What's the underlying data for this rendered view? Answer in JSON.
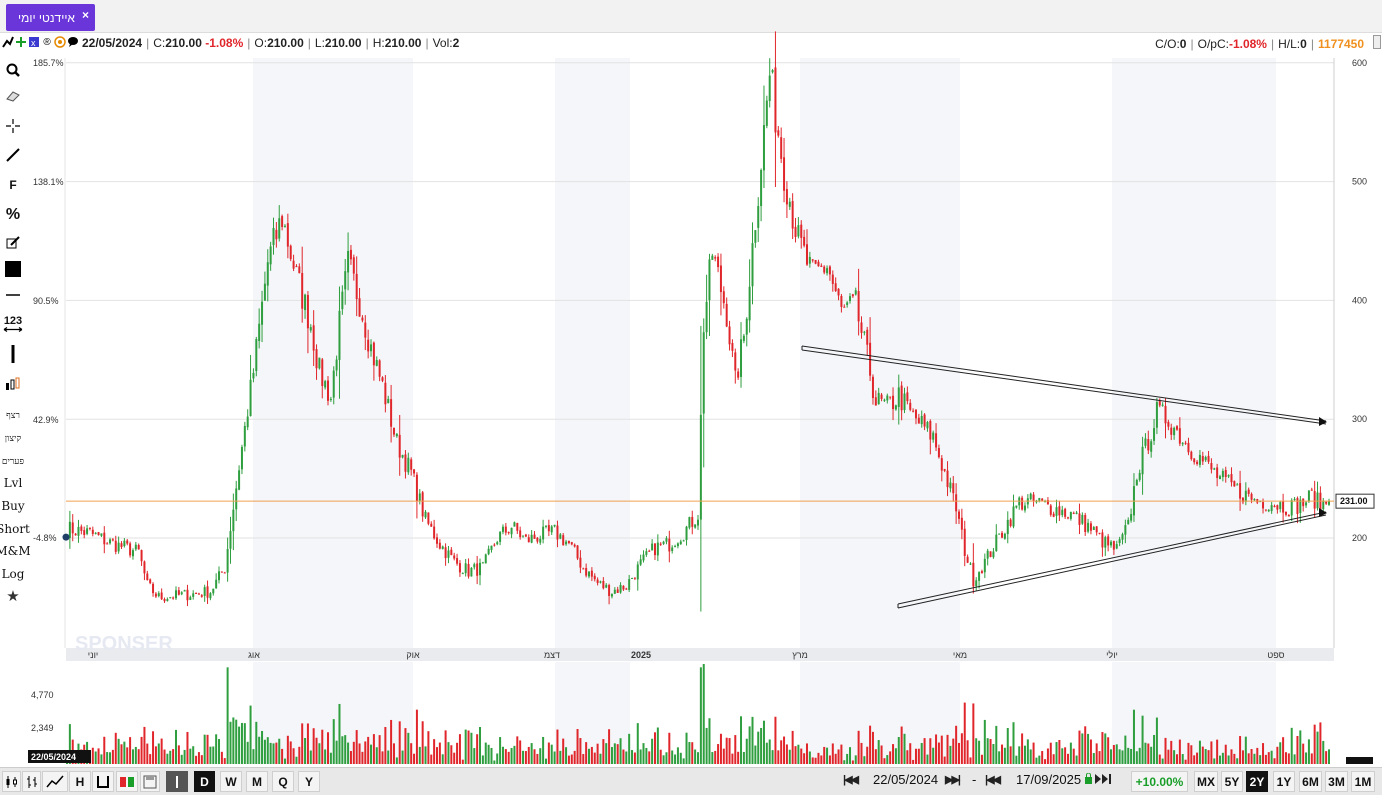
{
  "tab": {
    "title": "איידנטי יומי",
    "close": "×"
  },
  "info": {
    "date": "22/05/2024",
    "c_label": "C:",
    "c_value": "210.00",
    "c_change": "-1.08%",
    "o_label": "O:",
    "o_value": "210.00",
    "l_label": "L:",
    "l_value": "210.00",
    "h_label": "H:",
    "h_value": "210.00",
    "vol_label": "Vol:",
    "vol_value": "2",
    "co_label": "C/O:",
    "co_value": "0",
    "opc_label": "O/pC:",
    "opc_value": "-1.08%",
    "hl_label": "H/L:",
    "hl_value": "0",
    "symbol_id": "1177450"
  },
  "toolbar": {
    "items": [
      {
        "name": "search-icon",
        "label": ""
      },
      {
        "name": "eraser-icon",
        "label": ""
      },
      {
        "name": "crosshair-icon",
        "label": ""
      },
      {
        "name": "line-tool-icon",
        "label": ""
      },
      {
        "name": "fibonacci-tool",
        "label": "F"
      },
      {
        "name": "percent-tool",
        "label": "%"
      },
      {
        "name": "edit-icon",
        "label": ""
      },
      {
        "name": "color-swatch",
        "label": ""
      },
      {
        "name": "horizontal-line-icon",
        "label": ""
      },
      {
        "name": "numbering-tool",
        "label": "123"
      },
      {
        "name": "vertical-line-icon",
        "label": ""
      },
      {
        "name": "candles-icon",
        "label": ""
      },
      {
        "name": "tool-retzef",
        "label": "רצף"
      },
      {
        "name": "tool-kitzun",
        "label": "קיצון"
      },
      {
        "name": "tool-paarim",
        "label": "פערים"
      },
      {
        "name": "tool-lvl",
        "label": "Lvl"
      },
      {
        "name": "tool-buy",
        "label": "Buy"
      },
      {
        "name": "tool-short",
        "label": "Short"
      },
      {
        "name": "tool-mm",
        "label": "M&M"
      },
      {
        "name": "tool-log",
        "label": "Log"
      },
      {
        "name": "star-icon",
        "label": "★"
      }
    ]
  },
  "chart_data": {
    "type": "candlestick",
    "price_axis": {
      "ticks": [
        200,
        300,
        400,
        500,
        600
      ],
      "min": 120,
      "max": 600
    },
    "percent_axis": {
      "ticks": [
        "185.7%",
        "138.1%",
        "90.5%",
        "42.9%",
        "-4.8%"
      ]
    },
    "last_price_label": "231.00",
    "last_price": 231,
    "month_labels": [
      "יוני",
      "אוג",
      "אוק",
      "דצמ",
      "2025",
      "מרץ",
      "מאי",
      "יולי",
      "ספט"
    ],
    "volume_axis": {
      "ticks": [
        "4,770",
        "2,349"
      ]
    },
    "volume_cursor_label": "22/05/2024",
    "watermark": "SPONSER",
    "price_anchors": [
      [
        0,
        208
      ],
      [
        8,
        204
      ],
      [
        15,
        196
      ],
      [
        25,
        188
      ],
      [
        28,
        160
      ],
      [
        32,
        150
      ],
      [
        45,
        153
      ],
      [
        50,
        155
      ],
      [
        55,
        175
      ],
      [
        60,
        260
      ],
      [
        65,
        340
      ],
      [
        70,
        432
      ],
      [
        75,
        470
      ],
      [
        80,
        420
      ],
      [
        85,
        380
      ],
      [
        88,
        340
      ],
      [
        92,
        318
      ],
      [
        95,
        380
      ],
      [
        98,
        430
      ],
      [
        102,
        400
      ],
      [
        106,
        360
      ],
      [
        110,
        328
      ],
      [
        115,
        280
      ],
      [
        120,
        255
      ],
      [
        125,
        215
      ],
      [
        130,
        195
      ],
      [
        135,
        180
      ],
      [
        140,
        172
      ],
      [
        145,
        175
      ],
      [
        150,
        200
      ],
      [
        155,
        210
      ],
      [
        160,
        198
      ],
      [
        165,
        202
      ],
      [
        170,
        205
      ],
      [
        175,
        195
      ],
      [
        180,
        175
      ],
      [
        185,
        162
      ],
      [
        190,
        155
      ],
      [
        195,
        160
      ],
      [
        200,
        178
      ],
      [
        205,
        192
      ],
      [
        210,
        195
      ],
      [
        215,
        205
      ],
      [
        220,
        220
      ],
      [
        222,
        380
      ],
      [
        225,
        440
      ],
      [
        230,
        390
      ],
      [
        233,
        330
      ],
      [
        236,
        370
      ],
      [
        240,
        470
      ],
      [
        245,
        590
      ],
      [
        250,
        510
      ],
      [
        255,
        450
      ],
      [
        260,
        420
      ],
      [
        265,
        430
      ],
      [
        270,
        390
      ],
      [
        275,
        395
      ],
      [
        280,
        340
      ],
      [
        282,
        315
      ],
      [
        286,
        310
      ],
      [
        290,
        320
      ],
      [
        294,
        305
      ],
      [
        298,
        295
      ],
      [
        302,
        285
      ],
      [
        306,
        255
      ],
      [
        310,
        225
      ],
      [
        313,
        190
      ],
      [
        316,
        165
      ],
      [
        320,
        180
      ],
      [
        326,
        205
      ],
      [
        332,
        230
      ],
      [
        338,
        230
      ],
      [
        344,
        225
      ],
      [
        350,
        220
      ],
      [
        356,
        210
      ],
      [
        362,
        195
      ],
      [
        366,
        190
      ],
      [
        370,
        210
      ],
      [
        373,
        255
      ],
      [
        376,
        275
      ],
      [
        380,
        305
      ],
      [
        384,
        300
      ],
      [
        390,
        280
      ],
      [
        396,
        265
      ],
      [
        402,
        250
      ],
      [
        408,
        240
      ],
      [
        414,
        232
      ],
      [
        420,
        230
      ],
      [
        426,
        226
      ],
      [
        430,
        228
      ],
      [
        434,
        235
      ],
      [
        437,
        228
      ],
      [
        440,
        231
      ]
    ],
    "total_bars": 441,
    "trendlines": [
      {
        "from": [
          [
            802,
            346
          ],
          [
            1326,
            421
          ]
        ],
        "label": "upper"
      },
      {
        "from": [
          [
            898,
            604
          ],
          [
            1326,
            512
          ]
        ],
        "label": "lower"
      }
    ]
  },
  "bottom": {
    "period_buttons": [
      "D",
      "W",
      "M",
      "Q",
      "Y"
    ],
    "period_selected": "D",
    "start_date": "22/05/2024",
    "end_date": "17/09/2025",
    "change": "+10.00%",
    "range_buttons": [
      "MX",
      "5Y",
      "2Y",
      "1Y",
      "6M",
      "3M",
      "1M"
    ],
    "range_selected": "2Y",
    "dash": "-"
  }
}
